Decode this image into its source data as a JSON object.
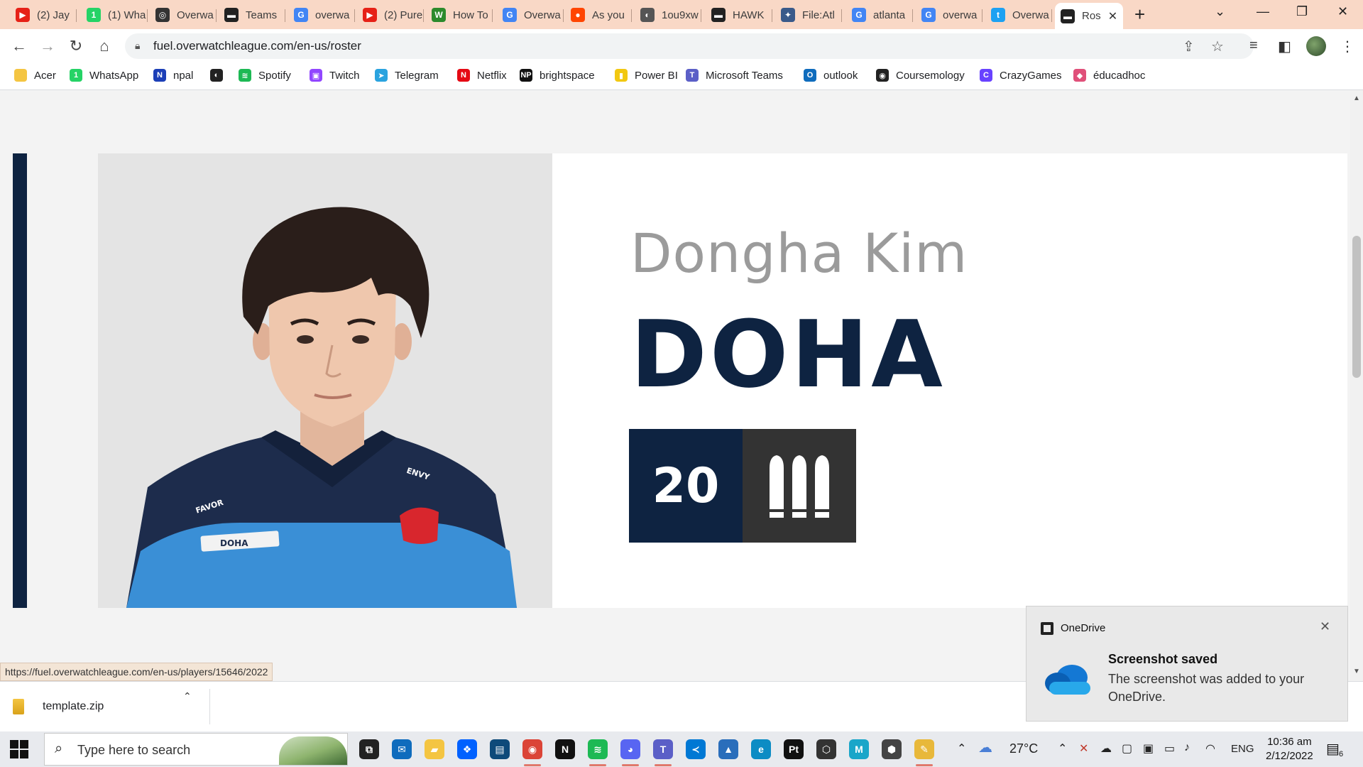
{
  "tabs": [
    {
      "title": "(2) Jay",
      "color": "#e62117",
      "glyph": "▶",
      "icon": "youtube-icon"
    },
    {
      "title": "(1) Wha",
      "color": "#25d366",
      "glyph": "1",
      "icon": "whatsapp-icon"
    },
    {
      "title": "Overwa",
      "color": "#333333",
      "glyph": "◎",
      "icon": "overwatch-icon"
    },
    {
      "title": "Teams",
      "color": "#222222",
      "glyph": "▬",
      "icon": "team-logo-icon"
    },
    {
      "title": "overwa",
      "color": "#4285f4",
      "glyph": "G",
      "icon": "google-icon"
    },
    {
      "title": "(2) Pure",
      "color": "#e62117",
      "glyph": "▶",
      "icon": "youtube-icon"
    },
    {
      "title": "How To",
      "color": "#2c8a2c",
      "glyph": "W",
      "icon": "wikihow-icon"
    },
    {
      "title": "Overwa",
      "color": "#4285f4",
      "glyph": "G",
      "icon": "google-icon"
    },
    {
      "title": "As you",
      "color": "#ff4500",
      "glyph": "●",
      "icon": "reddit-icon"
    },
    {
      "title": "1ou9xw",
      "color": "#555555",
      "glyph": "◐",
      "icon": "globe-icon"
    },
    {
      "title": "HAWK",
      "color": "#222222",
      "glyph": "▬",
      "icon": "team-logo-icon"
    },
    {
      "title": "File:Atl",
      "color": "#3a5a8a",
      "glyph": "✦",
      "icon": "wiki-file-icon"
    },
    {
      "title": "atlanta",
      "color": "#4285f4",
      "glyph": "G",
      "icon": "google-icon"
    },
    {
      "title": "overwa",
      "color": "#4285f4",
      "glyph": "G",
      "icon": "google-icon"
    },
    {
      "title": "Overwa",
      "color": "#1da1f2",
      "glyph": "t",
      "icon": "twitter-icon"
    },
    {
      "title": "Ros",
      "color": "#222222",
      "glyph": "▬",
      "icon": "team-logo-icon",
      "active": true
    }
  ],
  "address_bar": {
    "url": "fuel.overwatchleague.com/en-us/roster"
  },
  "bookmarks": [
    {
      "label": "Acer",
      "color": "#f4c542",
      "glyph": "",
      "icon": "folder-icon"
    },
    {
      "label": "WhatsApp",
      "color": "#25d366",
      "glyph": "1",
      "icon": "whatsapp-icon"
    },
    {
      "label": "npal",
      "color": "#1c3fb7",
      "glyph": "N",
      "icon": "npal-icon"
    },
    {
      "label": "",
      "color": "#222222",
      "glyph": "◐",
      "icon": "globe-icon"
    },
    {
      "label": "Spotify",
      "color": "#1db954",
      "glyph": "≋",
      "icon": "spotify-icon"
    },
    {
      "label": "Twitch",
      "color": "#9146ff",
      "glyph": "▣",
      "icon": "twitch-icon"
    },
    {
      "label": "Telegram",
      "color": "#2aa3df",
      "glyph": "➤",
      "icon": "telegram-icon"
    },
    {
      "label": "Netflix",
      "color": "#e50914",
      "glyph": "N",
      "icon": "netflix-icon"
    },
    {
      "label": "brightspace",
      "color": "#111111",
      "glyph": "NP",
      "icon": "brightspace-icon"
    },
    {
      "label": "Power BI",
      "color": "#f2c811",
      "glyph": "▮",
      "icon": "powerbi-icon"
    },
    {
      "label": "Microsoft Teams",
      "color": "#5b5fc7",
      "glyph": "T",
      "icon": "teams-icon"
    },
    {
      "label": "outlook",
      "color": "#0f6cbd",
      "glyph": "O",
      "icon": "outlook-icon"
    },
    {
      "label": "Coursemology",
      "color": "#222222",
      "glyph": "◉",
      "icon": "coursemology-icon"
    },
    {
      "label": "CrazyGames",
      "color": "#6842ff",
      "glyph": "C",
      "icon": "crazygames-icon"
    },
    {
      "label": "éducadhoc",
      "color": "#e0507a",
      "glyph": "◆",
      "icon": "educadhoc-icon"
    }
  ],
  "player": {
    "real_name": "Dongha Kim",
    "handle": "DOHA",
    "number": "20",
    "role_icon": "damage-role-icon",
    "jersey_name": "DOHA",
    "sponsors": [
      "FAVOR",
      "ENVY"
    ],
    "team_color": "#0e2341",
    "role_color": "#333333"
  },
  "status_url": "https://fuel.overwatchleague.com/en-us/players/15646/2022",
  "download": {
    "filename": "template.zip"
  },
  "toast": {
    "app": "OneDrive",
    "title": "Screenshot saved",
    "body": "The screenshot was added to your OneDrive."
  },
  "taskbar": {
    "search_placeholder": "Type here to search",
    "apps": [
      {
        "icon": "task-view-icon",
        "glyph": "⧉",
        "color": "#222222"
      },
      {
        "icon": "mail-icon",
        "glyph": "✉",
        "color": "#0f6cbd"
      },
      {
        "icon": "file-explorer-icon",
        "glyph": "▰",
        "color": "#f4c542"
      },
      {
        "icon": "dropbox-icon",
        "glyph": "❖",
        "color": "#0061ff"
      },
      {
        "icon": "notebook-app-icon",
        "glyph": "▤",
        "color": "#0e4a7a"
      },
      {
        "icon": "chrome-icon",
        "glyph": "◉",
        "color": "#db4437",
        "running": true
      },
      {
        "icon": "netflix-icon",
        "glyph": "N",
        "color": "#111111"
      },
      {
        "icon": "spotify-icon",
        "glyph": "≋",
        "color": "#1db954",
        "running": true
      },
      {
        "icon": "discord-icon",
        "glyph": "◕",
        "color": "#5865f2",
        "running": true
      },
      {
        "icon": "teams-icon",
        "glyph": "T",
        "color": "#5b5fc7",
        "running": true
      },
      {
        "icon": "vscode-icon",
        "glyph": "≺",
        "color": "#0078d4"
      },
      {
        "icon": "photos-icon",
        "glyph": "▲",
        "color": "#2a6ebb"
      },
      {
        "icon": "edge-icon",
        "glyph": "e",
        "color": "#0c8cc4"
      },
      {
        "icon": "pycharm-icon",
        "glyph": "Pt",
        "color": "#111111"
      },
      {
        "icon": "unity-icon",
        "glyph": "⬡",
        "color": "#333333"
      },
      {
        "icon": "maya-icon",
        "glyph": "M",
        "color": "#1aa6c9"
      },
      {
        "icon": "unity-hub-icon",
        "glyph": "⬢",
        "color": "#444444"
      },
      {
        "icon": "python-icon",
        "glyph": "✎",
        "color": "#e8b83a",
        "running": true
      }
    ],
    "weather_temp": "27°C",
    "language": "ENG",
    "time": "10:36 am",
    "date": "2/12/2022",
    "notifications": "6"
  }
}
